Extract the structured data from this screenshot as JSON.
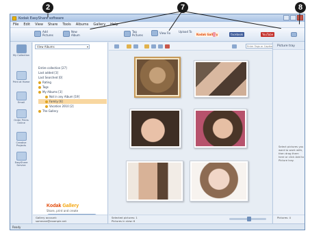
{
  "callouts": {
    "c2": "2",
    "c7": "7",
    "c8": "8"
  },
  "window": {
    "title": "Kodak EasyShare software"
  },
  "menu": [
    "File",
    "Edit",
    "View",
    "Share",
    "Tools",
    "Albums",
    "Gallery",
    "Help"
  ],
  "toolbar": {
    "add_pictures": "Add Pictures",
    "new_album": "New Album",
    "tag_pictures": "Tag Pictures",
    "view_fix": "View Fix",
    "upload_to": "Upload To",
    "share_kodak": "Kodak Gallery",
    "share_facebook": "facebook",
    "share_youtube": "YouTube"
  },
  "leftbar": [
    {
      "label": "My Collection"
    },
    {
      "label": "Print at Home"
    },
    {
      "label": "Email"
    },
    {
      "label": "Order Prints Online"
    },
    {
      "label": "Creative Projects"
    },
    {
      "label": "EasyShare Service"
    }
  ],
  "nav": {
    "view_select": "View Albums",
    "tree": [
      {
        "label": "Entire collection [27]"
      },
      {
        "label": "Last added [3]"
      },
      {
        "label": "Last Searched [0]"
      },
      {
        "label": "Rating"
      },
      {
        "label": "Tags"
      },
      {
        "label": "My Albums [3]"
      },
      {
        "label": "Not in any Album [19]"
      },
      {
        "label": "Family [6]"
      },
      {
        "label": "Vacation 2010 [2]"
      },
      {
        "label": "The Gallery"
      }
    ],
    "gallery_logo_a": "Kodak",
    "gallery_logo_b": "Gallery",
    "gallery_tagline": "Share, print and create",
    "gallery_button": "See the Latest Offers",
    "gallery_link": "Links to the Gallery",
    "footer_1": "Gallery account:",
    "footer_2": "someone@example.net"
  },
  "main": {
    "search_placeholder": "Enter Tags or Captions to Sear",
    "selected_pictures": "Selected pictures: 1",
    "pictures_in_view": "Pictures in view: 6",
    "zoom_fraction": 0.55
  },
  "tray": {
    "title": "Picture tray",
    "message": "Select pictures you want to work with, then drag them here or click Add to Picture tray.",
    "pictures_label": "Pictures:",
    "pictures_count": "4"
  },
  "statusbar": {
    "text": "Ready"
  },
  "colors": {
    "accent": "#f3a000",
    "kodak_red": "#e24400",
    "selection": "#f8d7a0"
  }
}
